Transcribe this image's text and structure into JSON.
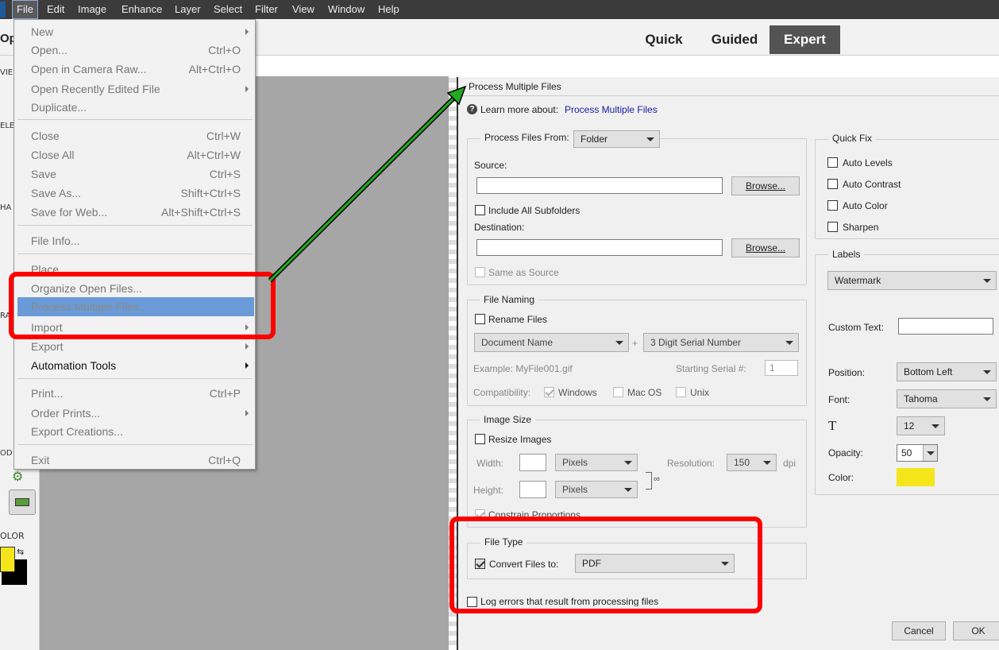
{
  "menubar": {
    "items": [
      "File",
      "Edit",
      "Image",
      "Enhance",
      "Layer",
      "Select",
      "Filter",
      "View",
      "Window",
      "Help"
    ]
  },
  "modes": {
    "quick": "Quick",
    "guided": "Guided",
    "expert": "Expert"
  },
  "left_panel": {
    "title_fragment": "Op",
    "view": "VIE",
    "select": "ELE",
    "enhance": "HA",
    "draw": "RA",
    "modify": "OD",
    "color": "OLOR"
  },
  "file_menu": {
    "items": [
      {
        "label": "New",
        "shortcut": "",
        "submenu": true,
        "enabled": false
      },
      {
        "label": "Open...",
        "shortcut": "Ctrl+O",
        "submenu": false,
        "enabled": false
      },
      {
        "label": "Open in Camera Raw...",
        "shortcut": "Alt+Ctrl+O",
        "submenu": false,
        "enabled": false
      },
      {
        "label": "Open Recently Edited File",
        "shortcut": "",
        "submenu": true,
        "enabled": false
      },
      {
        "label": "Duplicate...",
        "shortcut": "",
        "submenu": false,
        "enabled": false
      },
      {
        "label": "Close",
        "shortcut": "Ctrl+W",
        "submenu": false,
        "enabled": false
      },
      {
        "label": "Close All",
        "shortcut": "Alt+Ctrl+W",
        "submenu": false,
        "enabled": false
      },
      {
        "label": "Save",
        "shortcut": "Ctrl+S",
        "submenu": false,
        "enabled": false
      },
      {
        "label": "Save As...",
        "shortcut": "Shift+Ctrl+S",
        "submenu": false,
        "enabled": false
      },
      {
        "label": "Save for Web...",
        "shortcut": "Alt+Shift+Ctrl+S",
        "submenu": false,
        "enabled": false
      },
      {
        "label": "File Info...",
        "shortcut": "",
        "submenu": false,
        "enabled": false
      },
      {
        "label": "Place...",
        "shortcut": "",
        "submenu": false,
        "enabled": false
      },
      {
        "label": "Organize Open Files...",
        "shortcut": "",
        "submenu": false,
        "enabled": false
      },
      {
        "label": "Process Multiple Files...",
        "shortcut": "",
        "submenu": false,
        "enabled": false,
        "highlighted": true
      },
      {
        "label": "Import",
        "shortcut": "",
        "submenu": true,
        "enabled": false
      },
      {
        "label": "Export",
        "shortcut": "",
        "submenu": true,
        "enabled": false
      },
      {
        "label": "Automation Tools",
        "shortcut": "",
        "submenu": true,
        "enabled": true
      },
      {
        "label": "Print...",
        "shortcut": "Ctrl+P",
        "submenu": false,
        "enabled": false
      },
      {
        "label": "Order Prints...",
        "shortcut": "",
        "submenu": true,
        "enabled": false
      },
      {
        "label": "Export Creations...",
        "shortcut": "",
        "submenu": false,
        "enabled": false
      },
      {
        "label": "Exit",
        "shortcut": "Ctrl+Q",
        "submenu": false,
        "enabled": false
      }
    ]
  },
  "dialog": {
    "title": "Process Multiple Files",
    "help_prefix": "Learn more about:",
    "help_link": "Process Multiple Files",
    "process_from_label": "Process Files From:",
    "process_from_value": "Folder",
    "source_label": "Source:",
    "source_value": "",
    "browse": "Browse...",
    "include_subfolders": "Include All Subfolders",
    "destination_label": "Destination:",
    "destination_value": "",
    "same_as_source": "Same as Source",
    "file_naming": {
      "title": "File Naming",
      "rename": "Rename Files",
      "name_part1": "Document Name",
      "plus": "+",
      "name_part2": "3 Digit Serial Number",
      "example": "Example: MyFile001.gif",
      "starting_serial_label": "Starting Serial #:",
      "starting_serial_value": "1",
      "compatibility_label": "Compatibility:",
      "windows": "Windows",
      "mac": "Mac OS",
      "unix": "Unix"
    },
    "image_size": {
      "title": "Image Size",
      "resize": "Resize Images",
      "width_label": "Width:",
      "height_label": "Height:",
      "width_unit": "Pixels",
      "height_unit": "Pixels",
      "resolution_label": "Resolution:",
      "resolution_value": "150",
      "resolution_unit": "dpi",
      "constrain": "Constrain Proportions"
    },
    "file_type": {
      "title": "File Type",
      "convert": "Convert Files to:",
      "format": "PDF"
    },
    "log_errors": "Log errors that result from processing files",
    "quick_fix": {
      "title": "Quick Fix",
      "items": [
        "Auto Levels",
        "Auto Contrast",
        "Auto Color",
        "Sharpen"
      ]
    },
    "labels": {
      "title": "Labels",
      "type": "Watermark",
      "custom_text_label": "Custom Text:",
      "custom_text_value": "",
      "position_label": "Position:",
      "position_value": "Bottom Left",
      "font_label": "Font:",
      "font_value": "Tahoma",
      "font_size_icon": "T",
      "font_size_value": "12",
      "opacity_label": "Opacity:",
      "opacity_value": "50",
      "color_label": "Color:",
      "color_swatch": "#f5e61c"
    },
    "cancel": "Cancel",
    "ok": "OK"
  },
  "colors": {
    "annotation_red": "#ff0000",
    "arrow_green": "#22aa22",
    "foreground": "#f5e61c",
    "background": "#000000",
    "menu_highlight": "#6a9bd8"
  }
}
